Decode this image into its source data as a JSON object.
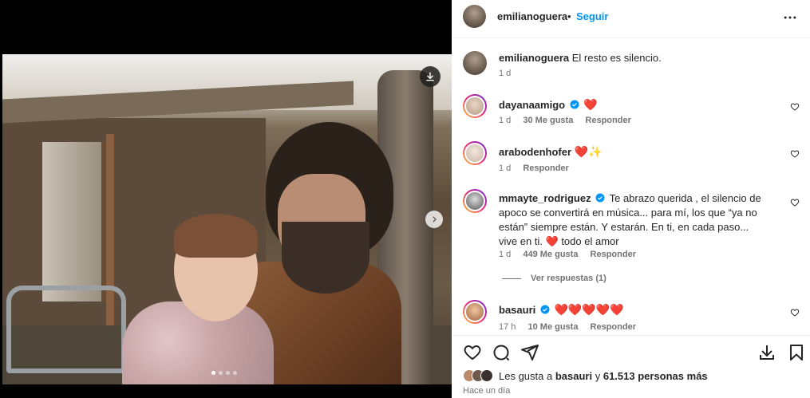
{
  "post": {
    "author": "emilianoguera",
    "dot": "•",
    "follow_label": "Seguir"
  },
  "caption": {
    "user": "emilianoguera",
    "text": "El resto es silencio.",
    "age": "1 d"
  },
  "comments": [
    {
      "user": "dayanaamigo",
      "verified": true,
      "text": "❤️",
      "age": "1 d",
      "likes": "30 Me gusta",
      "reply": "Responder"
    },
    {
      "user": "arabodenhofer",
      "verified": false,
      "text": "❤️✨",
      "age": "1 d",
      "likes": "",
      "reply": "Responder"
    },
    {
      "user": "mmayte_rodriguez",
      "verified": true,
      "text": "Te abrazo querida , el silencio de apoco se convertirá en música... para mí, los que “ya no están” siempre están. Y estarán. En ti, en cada paso... vive en ti. ❤️ todo el amor",
      "age": "1 d",
      "likes": "449 Me gusta",
      "reply": "Responder"
    },
    {
      "user": "basauri",
      "verified": true,
      "text": "❤️❤️❤️❤️❤️",
      "age": "17 h",
      "likes": "10 Me gusta",
      "reply": "Responder"
    }
  ],
  "view_replies": "Ver respuestas (1)",
  "likes_summary": {
    "prefix": "Les gusta a",
    "user": "basauri",
    "middle": "y",
    "count": "61.513 personas más"
  },
  "timestamp": "Hace un día",
  "carousel": {
    "total": 4,
    "active": 1
  },
  "colors": {
    "accent": "#0095f6",
    "heart": "#ed1b3a",
    "muted": "#737373"
  },
  "icons": [
    "download-icon",
    "chevron-right-icon",
    "more-icon",
    "heart-icon",
    "comment-icon",
    "share-icon",
    "save-icon",
    "verified-icon"
  ]
}
